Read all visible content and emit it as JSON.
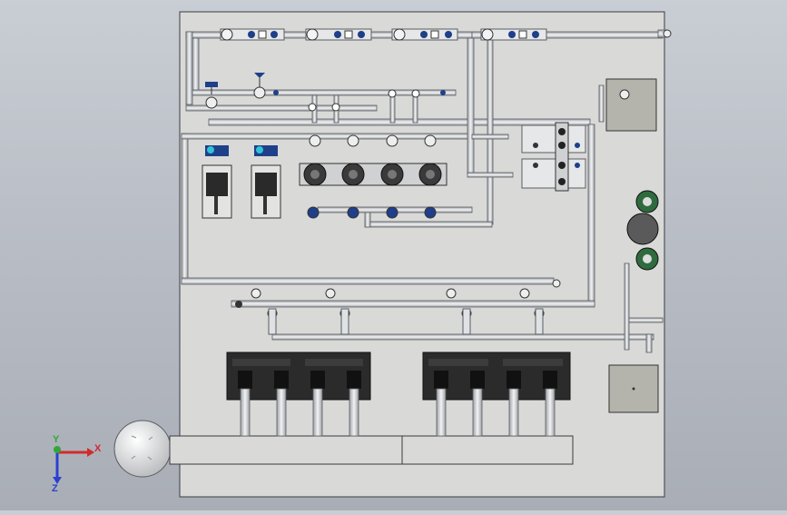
{
  "viewport": {
    "background_top": "#c9cdd4",
    "background_bottom": "#a9aeb6",
    "panel_color": "#d9d9d7",
    "pipe_color": "#dfe2e5",
    "pipe_edge": "#5a5d61",
    "valve_accent": "#1f3f8a",
    "pump_color": "#3a3a3a",
    "gauge_green": "#2f6b3f",
    "gauge_cyan": "#2ec4d6"
  },
  "triad": {
    "x_label": "X",
    "y_label": "Y",
    "z_label": "Z",
    "x_color": "#d22b2b",
    "y_color": "#2fa83a",
    "z_color": "#2b3fd2"
  },
  "title_block": {
    "cell_left": "",
    "cell_right": ""
  }
}
